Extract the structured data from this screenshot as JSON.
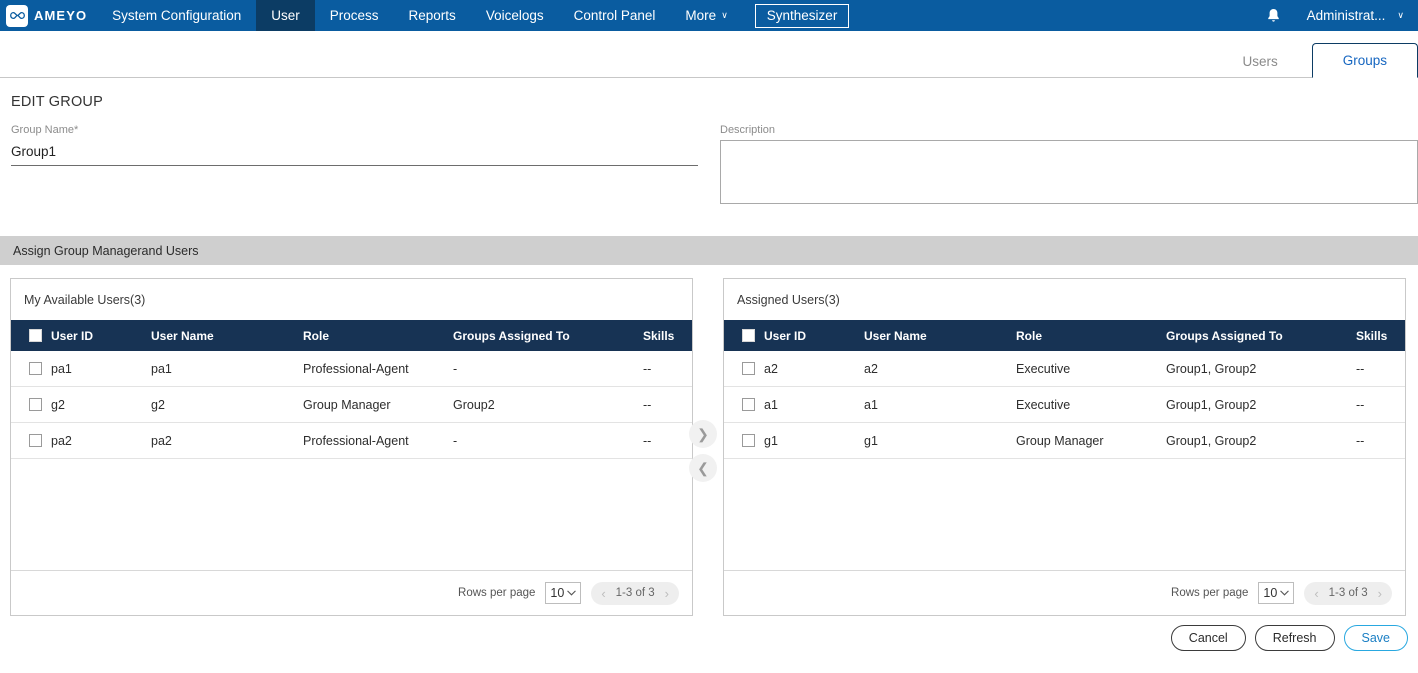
{
  "topnav": {
    "logo_text": "AMEYO",
    "items": [
      {
        "label": "System Configuration",
        "active": false
      },
      {
        "label": "User",
        "active": true
      },
      {
        "label": "Process",
        "active": false
      },
      {
        "label": "Reports",
        "active": false
      },
      {
        "label": "Voicelogs",
        "active": false
      },
      {
        "label": "Control Panel",
        "active": false
      }
    ],
    "more_label": "More",
    "more_caret": "∨",
    "synthesizer_label": "Synthesizer",
    "bell_icon": "bell-icon",
    "admin_label": "Administrat...",
    "admin_caret": "∨",
    "bg_color": "#0a5ca0",
    "active_bg_color": "#0c3c64"
  },
  "tabs": {
    "users_label": "Users",
    "groups_label": "Groups",
    "active": "Groups",
    "active_color": "#1666c0"
  },
  "page": {
    "title": "EDIT GROUP",
    "group_name_label": "Group Name*",
    "group_name_value": "Group1",
    "description_label": "Description",
    "description_value": "",
    "description_placeholder": "",
    "section_title": "Assign Group Managerand Users"
  },
  "columns": {
    "user_id": "User ID",
    "user_name": "User Name",
    "role": "Role",
    "groups_assigned_to": "Groups Assigned To",
    "skills": "Skills"
  },
  "available_panel": {
    "title": "My Available Users(3)",
    "rows": [
      {
        "user_id": "pa1",
        "user_name": "pa1",
        "role": "Professional-Agent",
        "groups": "-",
        "skills": "--"
      },
      {
        "user_id": "g2",
        "user_name": "g2",
        "role": "Group Manager",
        "groups": "Group2",
        "skills": "--"
      },
      {
        "user_id": "pa2",
        "user_name": "pa2",
        "role": "Professional-Agent",
        "groups": "-",
        "skills": "--"
      }
    ],
    "footer": {
      "rows_per_page_label": "Rows per page",
      "rows_per_page_value": "10",
      "range_text": "1-3 of 3",
      "prev_arrow": "‹",
      "next_arrow": "›"
    }
  },
  "assigned_panel": {
    "title": "Assigned Users(3)",
    "rows": [
      {
        "user_id": "a2",
        "user_name": "a2",
        "role": "Executive",
        "groups": "Group1, Group2",
        "skills": "--"
      },
      {
        "user_id": "a1",
        "user_name": "a1",
        "role": "Executive",
        "groups": "Group1, Group2",
        "skills": "--"
      },
      {
        "user_id": "g1",
        "user_name": "g1",
        "role": "Group Manager",
        "groups": "Group1, Group2",
        "skills": "--"
      }
    ],
    "footer": {
      "rows_per_page_label": "Rows per page",
      "rows_per_page_value": "10",
      "range_text": "1-3 of 3",
      "prev_arrow": "‹",
      "next_arrow": "›"
    }
  },
  "transfer": {
    "move_right_icon": "❯",
    "move_left_icon": "❮"
  },
  "actions": {
    "cancel_label": "Cancel",
    "refresh_label": "Refresh",
    "save_label": "Save",
    "save_accent_color": "#29a8e0"
  }
}
